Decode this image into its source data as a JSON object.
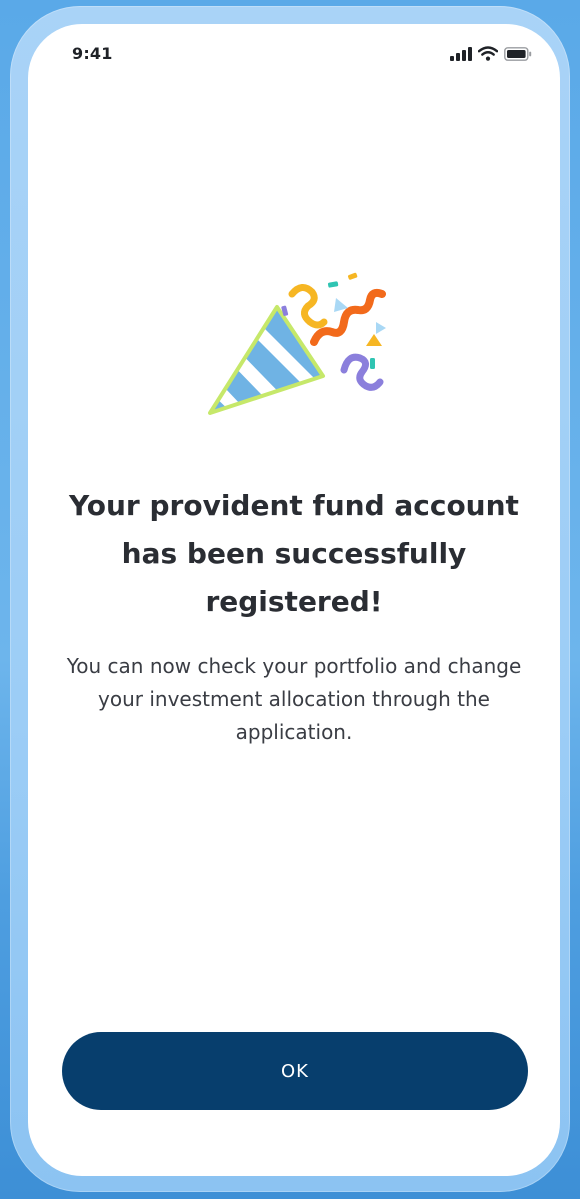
{
  "status_bar": {
    "time": "9:41",
    "icons": [
      "cellular-signal-icon",
      "wifi-icon",
      "battery-icon"
    ]
  },
  "illustration": {
    "icon": "party-popper-icon",
    "colors": {
      "cone_outline": "#c6e86a",
      "cone_stripes": "#6fb3e4",
      "confetti_orange": "#f26a1b",
      "confetti_yellow": "#f6b623",
      "confetti_purple": "#8b7fdc",
      "confetti_teal": "#2fc4b2",
      "confetti_lightblue": "#a9d8f5"
    }
  },
  "content": {
    "title": "Your provident fund account has been successfully registered!",
    "subtitle": "You can now check your portfolio and change your investment allocation through the application."
  },
  "actions": {
    "ok_label": "OK"
  },
  "colors": {
    "primary_button": "#073e6d",
    "screen_background": "#ffffff",
    "device_frame": "#9ccdf6",
    "page_background": "#5aa9e8"
  }
}
